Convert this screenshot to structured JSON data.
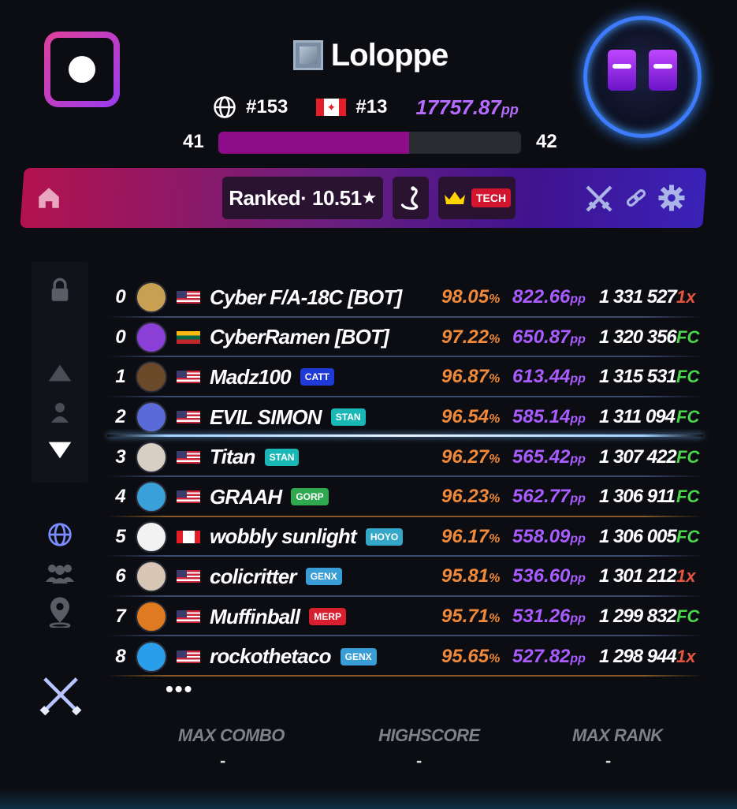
{
  "player": {
    "name": "Loloppe",
    "global_rank": "#153",
    "country_rank": "#13",
    "pp_value": "17757.87",
    "pp_unit": "pp",
    "level_current": "41",
    "level_next": "42",
    "level_progress": 0.63
  },
  "toolbar": {
    "ranked_label": "Ranked· 10.51",
    "star": "★",
    "tag": "TECH"
  },
  "leaderboard": [
    {
      "rank": "0",
      "name": "Cyber F/A-18C [BOT]",
      "flag": "us",
      "clan": "",
      "clan_color": "",
      "acc": "98.05",
      "pp": "822.66",
      "score": "1 331 527",
      "mod": "1x",
      "pfp": "#c9a052"
    },
    {
      "rank": "0",
      "name": "CyberRamen [BOT]",
      "flag": "lt",
      "clan": "",
      "clan_color": "",
      "acc": "97.22",
      "pp": "650.87",
      "score": "1 320 356",
      "mod": "FC",
      "pfp": "#8a3fd6"
    },
    {
      "rank": "1",
      "name": "Madz100",
      "flag": "us",
      "clan": "CATT",
      "clan_color": "#1f3ad6",
      "acc": "96.87",
      "pp": "613.44",
      "score": "1 315 531",
      "mod": "FC",
      "pfp": "#6b4a2a"
    },
    {
      "rank": "2",
      "name": "EVIL SIMON",
      "flag": "us",
      "clan": "STAN",
      "clan_color": "#1ab7b7",
      "acc": "96.54",
      "pp": "585.14",
      "score": "1 311 094",
      "mod": "FC",
      "pfp": "#5a6ad8"
    },
    {
      "rank": "3",
      "name": "Titan",
      "flag": "us",
      "clan": "STAN",
      "clan_color": "#1ab7b7",
      "acc": "96.27",
      "pp": "565.42",
      "score": "1 307 422",
      "mod": "FC",
      "pfp": "#d8cfc4"
    },
    {
      "rank": "4",
      "name": "GRAAH",
      "flag": "us",
      "clan": "GORP",
      "clan_color": "#2fa84f",
      "acc": "96.23",
      "pp": "562.77",
      "score": "1 306 911",
      "mod": "FC",
      "pfp": "#3aa0d8"
    },
    {
      "rank": "5",
      "name": "wobbly sunlight",
      "flag": "ca",
      "clan": "HOYO",
      "clan_color": "#35a7c9",
      "acc": "96.17",
      "pp": "558.09",
      "score": "1 306 005",
      "mod": "FC",
      "pfp": "#f2f2f2"
    },
    {
      "rank": "6",
      "name": "colicritter",
      "flag": "us",
      "clan": "GENX",
      "clan_color": "#3a9ed6",
      "acc": "95.81",
      "pp": "536.60",
      "score": "1 301 212",
      "mod": "1x",
      "pfp": "#d8c6b4"
    },
    {
      "rank": "7",
      "name": "Muffinball",
      "flag": "us",
      "clan": "MERP",
      "clan_color": "#d81f2f",
      "acc": "95.71",
      "pp": "531.26",
      "score": "1 299 832",
      "mod": "FC",
      "pfp": "#e07a20"
    },
    {
      "rank": "8",
      "name": "rockothetaco",
      "flag": "us",
      "clan": "GENX",
      "clan_color": "#3a9ed6",
      "acc": "95.65",
      "pp": "527.82",
      "score": "1 298 944",
      "mod": "1x",
      "pfp": "#2a9ee8"
    }
  ],
  "pct_symbol": "%",
  "pp_unit": "pp",
  "more": "•••",
  "stats": {
    "max_combo_label": "MAX COMBO",
    "max_combo_value": "-",
    "highscore_label": "HIGHSCORE",
    "highscore_value": "-",
    "max_rank_label": "MAX RANK",
    "max_rank_value": "-"
  },
  "colors": {
    "accuracy": "#f0893a",
    "pp": "#a95cff",
    "fc": "#4bd64b",
    "miss": "#e6553f",
    "toolbar_start": "#b3124e",
    "toolbar_end": "#3a22b8"
  },
  "icons": [
    "record-icon",
    "globe-icon",
    "home-icon",
    "snake-icon",
    "crown-icon",
    "swords-icon",
    "link-icon",
    "gear-icon",
    "lock-icon",
    "arrow-up-icon",
    "person-icon",
    "arrow-down-icon",
    "friends-icon",
    "location-icon",
    "lightsabers-icon"
  ]
}
